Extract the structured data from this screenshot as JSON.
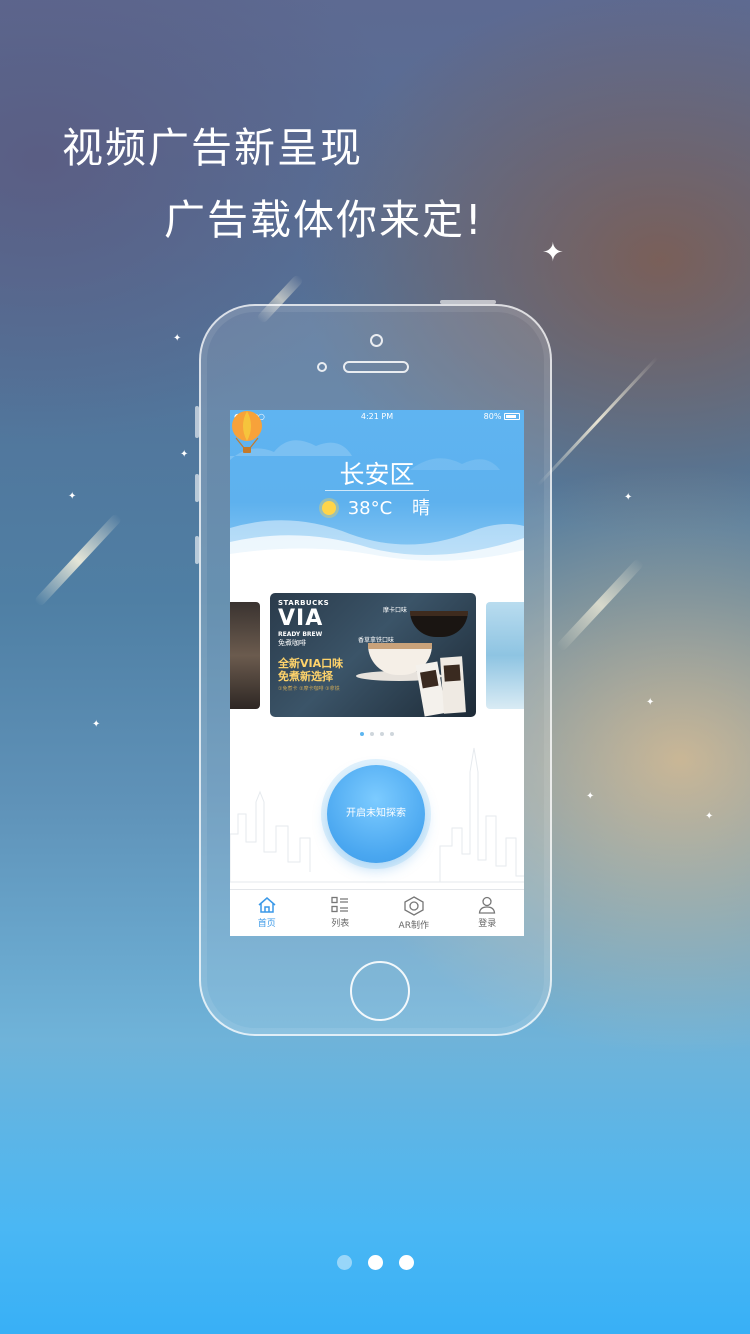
{
  "headline": {
    "line1": "视频广告新呈现",
    "line2": "广告载体你来定!"
  },
  "phone_screen": {
    "status_bar": {
      "carrier": "●●●○○",
      "time": "4:21 PM",
      "battery": "80%"
    },
    "weather": {
      "district": "长安区",
      "temperature": "38°C",
      "condition": "晴"
    },
    "banner": {
      "brand": "STARBUCKS",
      "product": "VIA",
      "ready_brew": "READY BREW",
      "subtitle": "免煮咖啡",
      "tagline1": "全新VIA口味",
      "tagline2": "免煮新选择",
      "fine_print": "①免煮卡 ②摩卡咖啡 ③拿铁",
      "label_mocha": "摩卡口味",
      "label_latte": "香草拿铁口味"
    },
    "carousel_pages": 4,
    "carousel_active": 1,
    "explore_button": "开启未知探索",
    "tabs": [
      {
        "label": "首页",
        "icon": "home-icon",
        "active": true
      },
      {
        "label": "列表",
        "icon": "list-icon",
        "active": false
      },
      {
        "label": "AR制作",
        "icon": "ar-icon",
        "active": false
      },
      {
        "label": "登录",
        "icon": "user-icon",
        "active": false
      }
    ]
  },
  "onboarding": {
    "pages": 3,
    "active": 2
  },
  "colors": {
    "accent": "#3b99e8",
    "weather_bg": "#5fb4f1",
    "banner_gold": "#ffd36a"
  }
}
